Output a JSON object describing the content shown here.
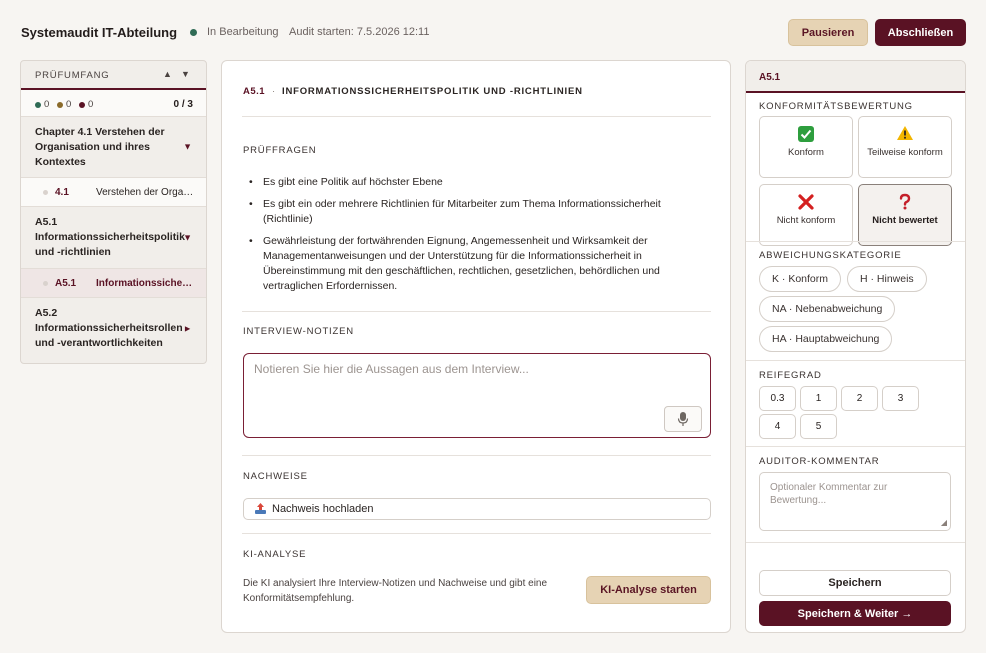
{
  "header": {
    "title": "Systemaudit IT-Abteilung",
    "status": "In Bearbeitung",
    "started": "Audit starten: 7.5.2026 12:11",
    "pause_label": "Pausieren",
    "finish_label": "Abschließen",
    "status_color": "#2f6b55"
  },
  "sidebar": {
    "title": "PRÜFUMFANG",
    "sort_up": "▲",
    "sort_down": "▼",
    "stats": [
      {
        "value": "0",
        "color": "#2f6b55"
      },
      {
        "value": "0",
        "color": "#8a6a2a"
      },
      {
        "value": "0",
        "color": "#5a1224"
      }
    ],
    "progress": "0 / 3",
    "chapters": [
      {
        "label": "Chapter 4.1 Verstehen der Organisation und ihres Kontextes",
        "arrow": "▼",
        "sub": {
          "num": "4.1",
          "label": "Verstehen der Organisation und ihres Kontextes"
        }
      },
      {
        "label": "A5.1 Informationssicherheitspolitik und -richtlinien",
        "arrow": "▼",
        "sub": {
          "num": "A5.1",
          "label": "Informationssicherheitspolitik und -richtlinien"
        }
      },
      {
        "label": "A5.2 Informationssicherheitsrollen und -verantwortlichkeiten",
        "arrow": "►"
      }
    ]
  },
  "main": {
    "code": "A5.1",
    "separator": "·",
    "title": "INFORMATIONSSICHERHEITSPOLITIK UND -RICHTLINIEN",
    "questions_heading": "PRÜFFRAGEN",
    "questions": [
      "Es gibt eine Politik auf höchster Ebene",
      "Es gibt ein oder mehrere Richtlinien für Mitarbeiter zum Thema Informationssicherheit (Richtlinie)",
      "Gewährleistung der fortwährenden Eignung, Angemessenheit und Wirksamkeit der Managementanweisungen und der Unterstützung für die Informationssicherheit in Übereinstimmung mit den geschäftlichen, rechtlichen, gesetzlichen, behördlichen und vertraglichen Erfordernissen."
    ],
    "notes_heading": "INTERVIEW-NOTIZEN",
    "notes_placeholder": "Notieren Sie hier die Aussagen aus dem Interview...",
    "notes_value": "",
    "evidence_heading": "NACHWEISE",
    "upload_label": "Nachweis hochladen",
    "ai_heading": "KI-ANALYSE",
    "ai_text": "Die KI analysiert Ihre Interview-Notizen und Nachweise und gibt eine Konformitätsempfehlung.",
    "ai_button": "KI-Analyse starten"
  },
  "rightpanel": {
    "code": "A5.1",
    "conformity_heading": "KONFORMITÄTSBEWERTUNG",
    "conformity_options": [
      {
        "label": "Konform",
        "icon": "check-icon",
        "color": "#2e9e3e"
      },
      {
        "label": "Teilweise konform",
        "icon": "warning-icon",
        "color": "#e0a800"
      },
      {
        "label": "Nicht konform",
        "icon": "cross-icon",
        "color": "#d42020"
      },
      {
        "label": "Nicht bewertet",
        "icon": "question-icon",
        "color": "#c41f2a",
        "selected": true
      }
    ],
    "deviation_heading": "ABWEICHUNGSKATEGORIE",
    "deviation_options": [
      "K · Konform",
      "H · Hinweis",
      "NA · Nebenabweichung",
      "HA · Hauptabweichung"
    ],
    "maturity_heading": "REIFEGRAD",
    "maturity_options": [
      "0.3",
      "1",
      "2",
      "3",
      "4",
      "5"
    ],
    "comment_heading": "AUDITOR-KOMMENTAR",
    "comment_placeholder": "Optionaler Kommentar zur Bewertung...",
    "save_label": "Speichern",
    "save_next_label": "Speichern & Weiter →"
  }
}
